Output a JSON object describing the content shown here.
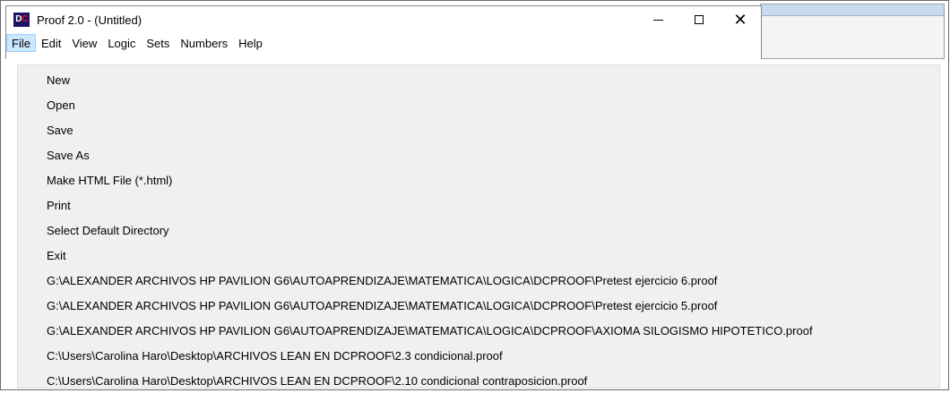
{
  "window": {
    "title": "Proof 2.0  -  (Untitled)",
    "icon_text_1": "D",
    "icon_text_2": "C",
    "controls": {
      "minimize_icon": "minimize-icon",
      "maximize_icon": "maximize-icon",
      "close_glyph": "✕"
    }
  },
  "menubar": {
    "items": [
      "File",
      "Edit",
      "View",
      "Logic",
      "Sets",
      "Numbers",
      "Help"
    ]
  },
  "file_menu": {
    "items": [
      "New",
      "Open",
      "Save",
      "Save As",
      "Make HTML File   (*.html)",
      "Print",
      "Select Default Directory",
      "Exit",
      "G:\\ALEXANDER ARCHIVOS HP PAVILION G6\\AUTOAPRENDIZAJE\\MATEMATICA\\LOGICA\\DCPROOF\\Pretest ejercicio  6.proof",
      "G:\\ALEXANDER ARCHIVOS HP PAVILION G6\\AUTOAPRENDIZAJE\\MATEMATICA\\LOGICA\\DCPROOF\\Pretest ejercicio  5.proof",
      "G:\\ALEXANDER ARCHIVOS HP PAVILION G6\\AUTOAPRENDIZAJE\\MATEMATICA\\LOGICA\\DCPROOF\\AXIOMA SILOGISMO HIPOTETICO.proof",
      "C:\\Users\\Carolina Haro\\Desktop\\ARCHIVOS LEAN EN DCPROOF\\2.3  condicional.proof",
      "C:\\Users\\Carolina Haro\\Desktop\\ARCHIVOS LEAN EN DCPROOF\\2.10 condicional contraposicion.proof"
    ]
  },
  "colors": {
    "menu_highlight": "#cce8ff",
    "dropdown_bg": "#f0f0f0",
    "icon_bg": "#1b1464",
    "icon_accent": "#e81123"
  }
}
